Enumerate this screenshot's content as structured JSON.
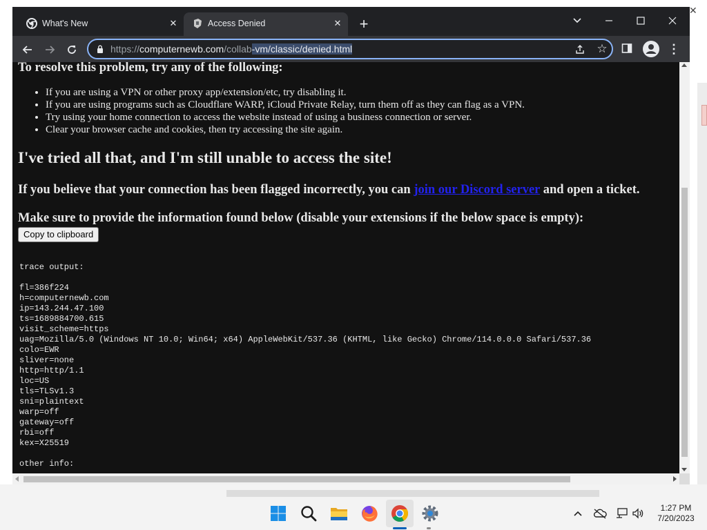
{
  "browser": {
    "tabs": [
      {
        "title": "What's New"
      },
      {
        "title": "Access Denied"
      }
    ],
    "url": {
      "scheme": "https://",
      "host": "computernewb.com",
      "path_pre": "/collab",
      "path_selected": "-vm/classic/denied.html"
    }
  },
  "page": {
    "resolve_heading": "To resolve this problem, try any of the following:",
    "tips": [
      "If you are using a VPN or other proxy app/extension/etc, try disabling it.",
      "If you are using programs such as Cloudflare WARP, iCloud Private Relay, turn them off as they can flag as a VPN.",
      "Try using your home connection to access the website instead of using a business connection or server.",
      "Clear your browser cache and cookies, then try accessing the site again."
    ],
    "tried_heading": "I've tried all that, and I'm still unable to access the site!",
    "flag_text_pre": "If you believe that your connection has been flagged incorrectly, you can ",
    "flag_link": "join our Discord server",
    "flag_text_post": " and open a ticket.",
    "make_sure": "Make sure to provide the information found below (disable your extensions if the below space is empty):",
    "copy_button": "Copy to clipboard",
    "trace_lines": [
      "trace output:",
      "",
      "fl=386f224",
      "h=computernewb.com",
      "ip=143.244.47.100",
      "ts=1689884700.615",
      "visit_scheme=https",
      "uag=Mozilla/5.0 (Windows NT 10.0; Win64; x64) AppleWebKit/537.36 (KHTML, like Gecko) Chrome/114.0.0.0 Safari/537.36",
      "colo=EWR",
      "sliver=none",
      "http=http/1.1",
      "loc=US",
      "tls=TLSv1.3",
      "sni=plaintext",
      "warp=off",
      "gateway=off",
      "rbi=off",
      "kex=X25519",
      "",
      "other info:"
    ]
  },
  "taskbar": {
    "time": "1:27 PM",
    "date": "7/20/2023"
  },
  "colors": {
    "page_bg": "#121212",
    "link": "#2222ee",
    "omnibox_focus": "#8ab4f8",
    "chrome_dark": "#202124",
    "chrome_toolbar": "#35363a"
  }
}
